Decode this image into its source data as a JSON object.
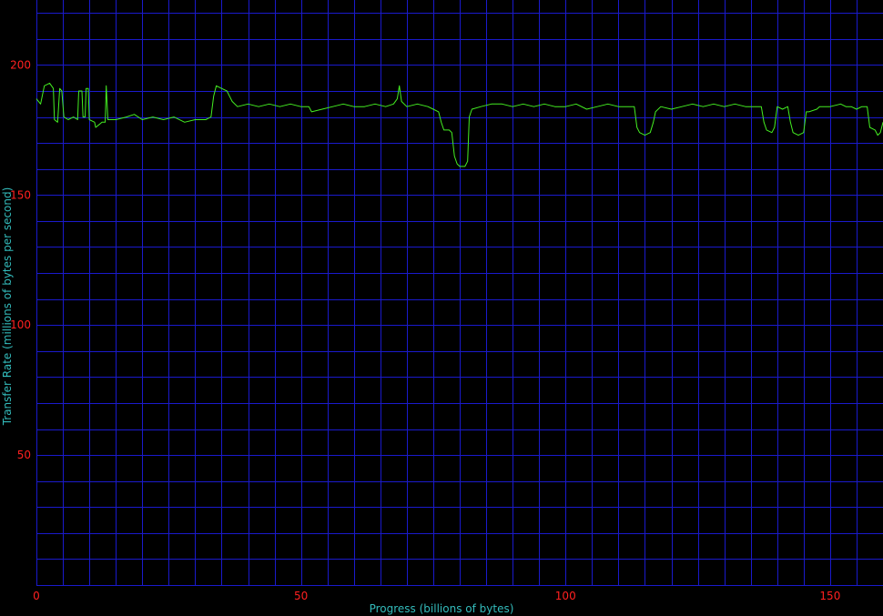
{
  "chart_data": {
    "type": "line",
    "title": "",
    "xlabel": "Progress (billions of bytes)",
    "ylabel": "Transfer Rate (millions of bytes per second)",
    "xlim": [
      0,
      160
    ],
    "ylim": [
      0,
      225
    ],
    "x_ticks": [
      {
        "value": 0,
        "label": "0"
      },
      {
        "value": 50,
        "label": "50"
      },
      {
        "value": 100,
        "label": "100"
      },
      {
        "value": 150,
        "label": "150"
      }
    ],
    "y_ticks": [
      {
        "value": 50,
        "label": "50"
      },
      {
        "value": 100,
        "label": "100"
      },
      {
        "value": 150,
        "label": "150"
      },
      {
        "value": 200,
        "label": "200"
      }
    ],
    "x_grid_step": 5,
    "y_grid_step": 10,
    "grid": true,
    "legend": "none",
    "colors": {
      "background": "#000000",
      "grid": "#1a1acc",
      "line": "#44ee22",
      "tick_label": "#ff2020",
      "axis_title": "#33bbbb"
    },
    "series": [
      {
        "values": [
          [
            0.0,
            187
          ],
          [
            0.8,
            185
          ],
          [
            1.5,
            192
          ],
          [
            2.5,
            193
          ],
          [
            3.2,
            191
          ],
          [
            3.4,
            179
          ],
          [
            4.0,
            178
          ],
          [
            4.4,
            191
          ],
          [
            4.8,
            190
          ],
          [
            5.2,
            180
          ],
          [
            6.0,
            179
          ],
          [
            7.0,
            180
          ],
          [
            7.8,
            179
          ],
          [
            8.0,
            190
          ],
          [
            8.6,
            190
          ],
          [
            8.8,
            180
          ],
          [
            9.2,
            180
          ],
          [
            9.4,
            191
          ],
          [
            9.8,
            191
          ],
          [
            10.0,
            179
          ],
          [
            11.0,
            178
          ],
          [
            11.2,
            176
          ],
          [
            11.8,
            177
          ],
          [
            12.4,
            178
          ],
          [
            13.0,
            178
          ],
          [
            13.2,
            192
          ],
          [
            13.5,
            179
          ],
          [
            15.0,
            179
          ],
          [
            17.0,
            180
          ],
          [
            18.5,
            181
          ],
          [
            20.0,
            179
          ],
          [
            22.0,
            180
          ],
          [
            24.0,
            179
          ],
          [
            26.0,
            180
          ],
          [
            28.0,
            178
          ],
          [
            30.0,
            179
          ],
          [
            32.0,
            179
          ],
          [
            33.0,
            180
          ],
          [
            33.5,
            188
          ],
          [
            34.0,
            192
          ],
          [
            35.0,
            191
          ],
          [
            36.0,
            190
          ],
          [
            37.0,
            186
          ],
          [
            38.0,
            184
          ],
          [
            40.0,
            185
          ],
          [
            42.0,
            184
          ],
          [
            44.0,
            185
          ],
          [
            46.0,
            184
          ],
          [
            48.0,
            185
          ],
          [
            50.0,
            184
          ],
          [
            51.5,
            184
          ],
          [
            52.0,
            182
          ],
          [
            54.0,
            183
          ],
          [
            56.0,
            184
          ],
          [
            58.0,
            185
          ],
          [
            60.0,
            184
          ],
          [
            62.0,
            184
          ],
          [
            64.0,
            185
          ],
          [
            66.0,
            184
          ],
          [
            67.5,
            185
          ],
          [
            68.2,
            187
          ],
          [
            68.6,
            192
          ],
          [
            69.0,
            186
          ],
          [
            70.0,
            184
          ],
          [
            72.0,
            185
          ],
          [
            74.0,
            184
          ],
          [
            75.0,
            183
          ],
          [
            76.0,
            182
          ],
          [
            76.5,
            178
          ],
          [
            77.0,
            175
          ],
          [
            78.0,
            175
          ],
          [
            78.5,
            174
          ],
          [
            79.0,
            165
          ],
          [
            79.5,
            162
          ],
          [
            80.0,
            161
          ],
          [
            81.0,
            161
          ],
          [
            81.5,
            163
          ],
          [
            81.8,
            180
          ],
          [
            82.3,
            183
          ],
          [
            84.0,
            184
          ],
          [
            86.0,
            185
          ],
          [
            88.0,
            185
          ],
          [
            90.0,
            184
          ],
          [
            92.0,
            185
          ],
          [
            94.0,
            184
          ],
          [
            96.0,
            185
          ],
          [
            98.0,
            184
          ],
          [
            100.0,
            184
          ],
          [
            102.0,
            185
          ],
          [
            104.0,
            183
          ],
          [
            106.0,
            184
          ],
          [
            108.0,
            185
          ],
          [
            110.0,
            184
          ],
          [
            113.0,
            184
          ],
          [
            113.5,
            176
          ],
          [
            114.0,
            174
          ],
          [
            115.0,
            173
          ],
          [
            116.0,
            174
          ],
          [
            116.6,
            178
          ],
          [
            117.0,
            182
          ],
          [
            118.0,
            184
          ],
          [
            120.0,
            183
          ],
          [
            122.0,
            184
          ],
          [
            124.0,
            185
          ],
          [
            126.0,
            184
          ],
          [
            128.0,
            185
          ],
          [
            130.0,
            184
          ],
          [
            132.0,
            185
          ],
          [
            134.0,
            184
          ],
          [
            137.0,
            184
          ],
          [
            137.5,
            178
          ],
          [
            138.0,
            175
          ],
          [
            139.0,
            174
          ],
          [
            139.5,
            176
          ],
          [
            140.0,
            184
          ],
          [
            141.0,
            183
          ],
          [
            142.0,
            184
          ],
          [
            142.5,
            178
          ],
          [
            143.0,
            174
          ],
          [
            144.0,
            173
          ],
          [
            145.0,
            174
          ],
          [
            145.5,
            182
          ],
          [
            146.0,
            182
          ],
          [
            147.5,
            183
          ],
          [
            148.0,
            184
          ],
          [
            150.0,
            184
          ],
          [
            152.0,
            185
          ],
          [
            153.0,
            184
          ],
          [
            154.0,
            184
          ],
          [
            155.0,
            183
          ],
          [
            156.0,
            184
          ],
          [
            157.0,
            184
          ],
          [
            157.5,
            176
          ],
          [
            158.5,
            175
          ],
          [
            159.0,
            173
          ],
          [
            159.5,
            174
          ],
          [
            160.0,
            178
          ]
        ]
      }
    ]
  }
}
